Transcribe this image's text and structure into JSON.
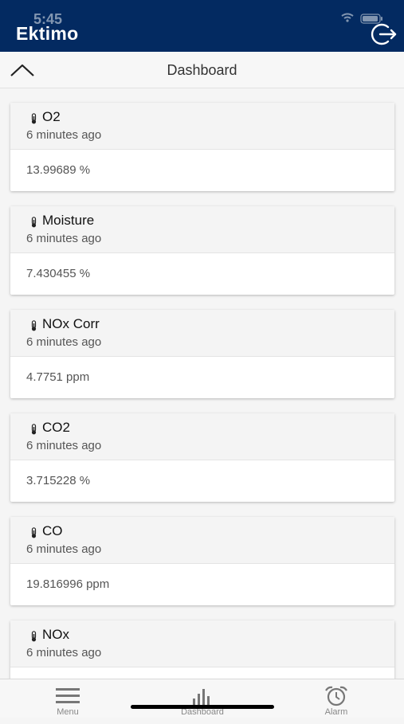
{
  "status_bar": {
    "time": "5:45"
  },
  "app_bar": {
    "brand": "Ektimo"
  },
  "sub_header": {
    "title": "Dashboard"
  },
  "readings": [
    {
      "name": "O2",
      "time": "6 minutes ago",
      "value": "13.99689 %"
    },
    {
      "name": "Moisture",
      "time": "6 minutes ago",
      "value": "7.430455 %"
    },
    {
      "name": "NOx Corr",
      "time": "6 minutes ago",
      "value": "4.7751 ppm"
    },
    {
      "name": "CO2",
      "time": "6 minutes ago",
      "value": "3.715228 %"
    },
    {
      "name": "CO",
      "time": "6 minutes ago",
      "value": "19.816996 ppm"
    },
    {
      "name": "NOx",
      "time": "6 minutes ago",
      "value": ""
    }
  ],
  "tab_bar": {
    "menu": {
      "label": "Menu",
      "icon": "hamburger-icon"
    },
    "dashboard": {
      "label": "Dashboard",
      "icon": "bar-chart-icon"
    },
    "alarm": {
      "label": "Alarm",
      "icon": "alarm-clock-icon"
    }
  },
  "colors": {
    "app_bar": "#032a61",
    "card_header": "#f4f4f4",
    "background": "#f5f5f5"
  }
}
